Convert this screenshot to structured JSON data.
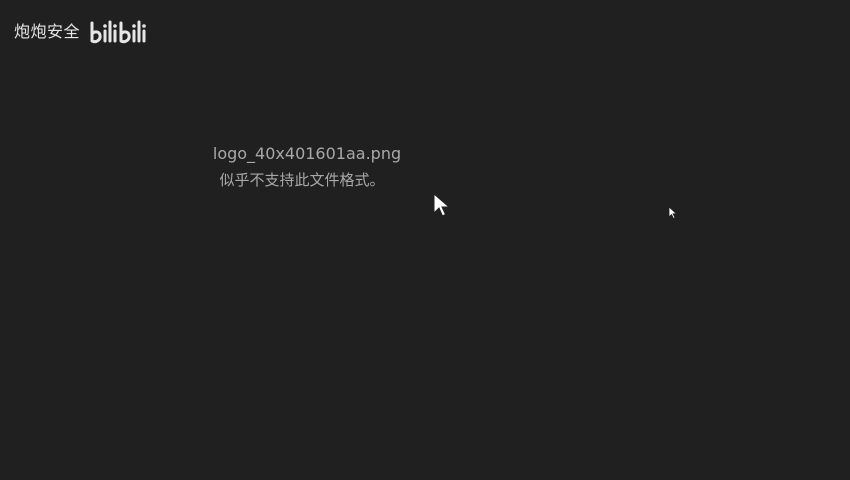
{
  "watermark": {
    "text": "炮炮安全",
    "logo_text": "bilibili"
  },
  "viewer": {
    "filename": "logo_40x401601aa.png",
    "error_message": "似乎不支持此文件格式。"
  },
  "colors": {
    "background": "#202020",
    "text": "#a8a8a8",
    "watermark": "#e6e6e6"
  },
  "icons": {
    "cursor_main": "mouse-pointer-icon",
    "cursor_secondary": "mouse-pointer-icon"
  }
}
